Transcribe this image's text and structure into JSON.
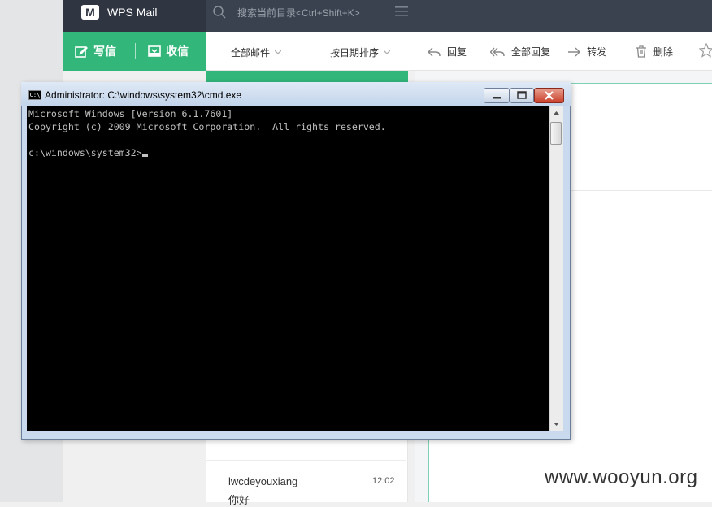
{
  "app": {
    "name": "WPS Mail",
    "logo_letter": "M"
  },
  "search": {
    "placeholder": "搜索当前目录<Ctrl+Shift+K>"
  },
  "actions": {
    "compose": "写信",
    "inbox": "收信"
  },
  "list_toolbar": {
    "filter": "全部邮件",
    "sort": "按日期排序"
  },
  "read_toolbar": {
    "reply": "回复",
    "reply_all": "全部回复",
    "forward": "转发",
    "delete": "删除"
  },
  "mail_list": [
    {
      "sender": "lwcdeyouxiang",
      "time": "12:02",
      "subject": "你好"
    }
  ],
  "cmd": {
    "title": "Administrator: C:\\windows\\system32\\cmd.exe",
    "icon_text": "C:\\",
    "lines": [
      "Microsoft Windows [Version 6.1.7601]",
      "Copyright (c) 2009 Microsoft Corporation.  All rights reserved.",
      "",
      "c:\\windows\\system32>"
    ]
  },
  "watermark": "www.wooyun.org",
  "colors": {
    "accent_green": "#32b67a",
    "header_dark": "#2f3541",
    "console_bg": "#000000",
    "console_fg": "#c0c0c0"
  }
}
